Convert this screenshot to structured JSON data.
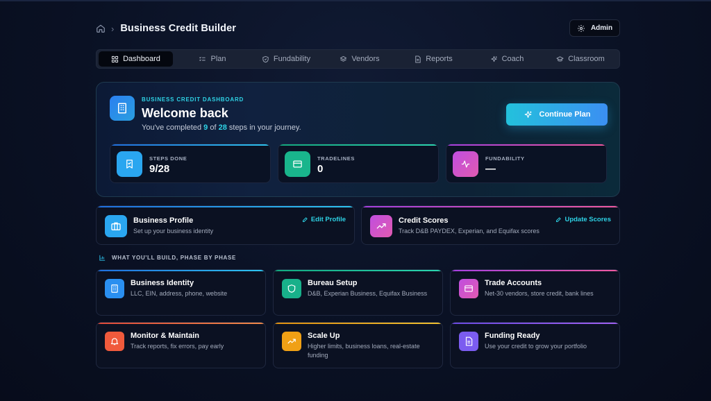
{
  "header": {
    "title": "Business Credit Builder",
    "separator": "›",
    "admin_label": "Admin"
  },
  "tabs": [
    {
      "label": "Dashboard",
      "icon": "grid-icon",
      "active": true
    },
    {
      "label": "Plan",
      "icon": "checklist-icon"
    },
    {
      "label": "Fundability",
      "icon": "shield-icon"
    },
    {
      "label": "Vendors",
      "icon": "layers-icon"
    },
    {
      "label": "Reports",
      "icon": "document-icon"
    },
    {
      "label": "Coach",
      "icon": "sparkle-icon"
    },
    {
      "label": "Classroom",
      "icon": "graduation-cap-icon"
    }
  ],
  "hero": {
    "kicker": "BUSINESS CREDIT DASHBOARD",
    "title": "Welcome back",
    "sub_prefix": "You've completed ",
    "done": "9",
    "sub_mid": " of ",
    "total": "28",
    "sub_suffix": " steps in your journey.",
    "cta": "Continue Plan"
  },
  "stats": [
    {
      "label": "STEPS DONE",
      "value": "9/28",
      "icon": "badge-check-icon",
      "color": "#2aa6f0"
    },
    {
      "label": "TRADELINES",
      "value": "0",
      "icon": "credit-card-icon",
      "color": "#19b58c"
    },
    {
      "label": "FUNDABILITY",
      "value": "—",
      "icon": "pulse-icon",
      "color": "#c04ee0"
    }
  ],
  "profile": {
    "title": "Business Profile",
    "desc": "Set up your business identity",
    "link": "Edit Profile"
  },
  "scores": {
    "title": "Credit Scores",
    "desc": "Track D&B PAYDEX, Experian, and Equifax scores",
    "link": "Update Scores"
  },
  "phases_heading": "WHAT YOU'LL BUILD, PHASE BY PHASE",
  "phases": [
    {
      "title": "Business Identity",
      "desc": "LLC, EIN, address, phone, website",
      "icon": "building-icon",
      "color": "#2a8ff0"
    },
    {
      "title": "Bureau Setup",
      "desc": "D&B, Experian Business, Equifax Business",
      "icon": "shield-icon",
      "color": "#18b08a"
    },
    {
      "title": "Trade Accounts",
      "desc": "Net-30 vendors, store credit, bank lines",
      "icon": "credit-card-icon",
      "color": "#c04ee0"
    },
    {
      "title": "Monitor & Maintain",
      "desc": "Track reports, fix errors, pay early",
      "icon": "bell-icon",
      "color": "#f05a3c"
    },
    {
      "title": "Scale Up",
      "desc": "Higher limits, business loans, real-estate funding",
      "icon": "trending-up-icon",
      "color": "#f0a015"
    },
    {
      "title": "Funding Ready",
      "desc": "Use your credit to grow your portfolio",
      "icon": "document-icon",
      "color": "#7b5cf0"
    }
  ]
}
